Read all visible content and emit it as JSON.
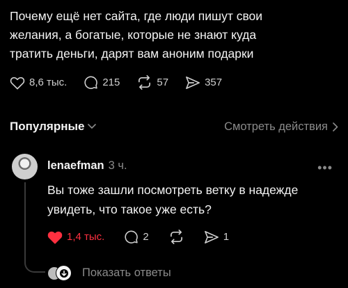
{
  "post": {
    "lines": [
      "Почему ещё нет сайта, где люди пишут свои",
      "желания, а богатые, которые не знают куда",
      "тратить деньги, дарят вам аноним подарки"
    ],
    "likes": "8,6 тыс.",
    "comments": "215",
    "reposts": "57",
    "shares": "357",
    "icons": [
      "heart-outline-icon",
      "comment-icon",
      "repost-icon",
      "share-icon"
    ]
  },
  "sort": {
    "label": "Популярные",
    "see_actions": "Смотреть действия"
  },
  "comment": {
    "username": "lenaefman",
    "time": "3 ч.",
    "text_lines": [
      "Вы тоже зашли посмотреть ветку в надежде",
      "увидеть, что такое уже есть?"
    ],
    "likes": "1,4 тыс.",
    "comments": "2",
    "shares": "1",
    "like_color": "#ff3040",
    "show_replies": "Показать ответы"
  }
}
